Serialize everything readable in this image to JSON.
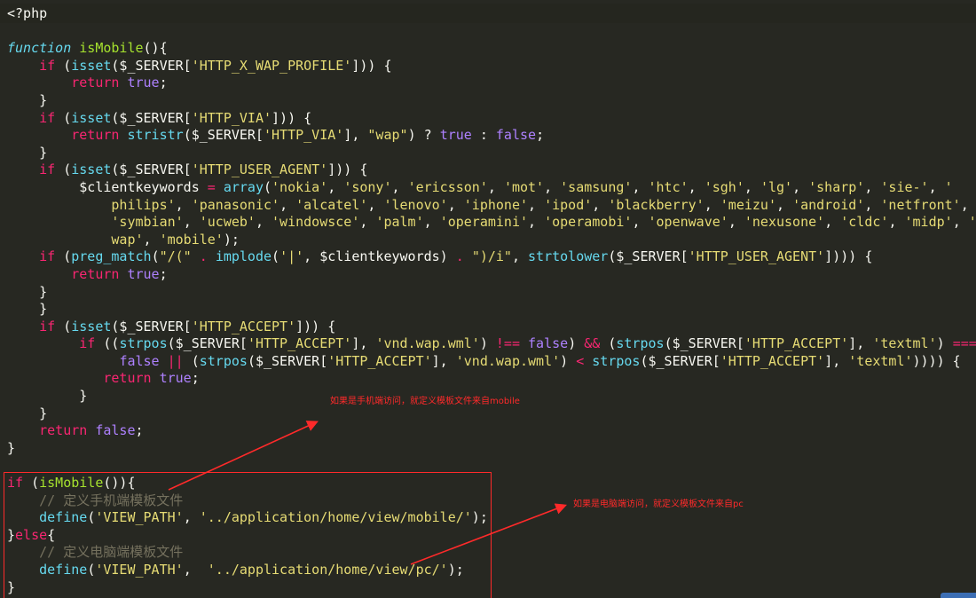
{
  "editor": {
    "lines": [
      [
        {
          "c": "pl",
          "t": "<?php"
        }
      ],
      [],
      [
        {
          "c": "fn",
          "t": "function"
        },
        {
          "c": "pl",
          "t": " "
        },
        {
          "c": "ent",
          "t": "isMobile"
        },
        {
          "c": "pl",
          "t": "(){"
        }
      ],
      [
        {
          "c": "pl",
          "t": "    "
        },
        {
          "c": "kw",
          "t": "if"
        },
        {
          "c": "pl",
          "t": " ("
        },
        {
          "c": "bi",
          "t": "isset"
        },
        {
          "c": "pl",
          "t": "($_SERVER["
        },
        {
          "c": "str",
          "t": "'HTTP_X_WAP_PROFILE'"
        },
        {
          "c": "pl",
          "t": "])) {"
        }
      ],
      [
        {
          "c": "pl",
          "t": "        "
        },
        {
          "c": "kw",
          "t": "return"
        },
        {
          "c": "pl",
          "t": " "
        },
        {
          "c": "const",
          "t": "true"
        },
        {
          "c": "pl",
          "t": ";"
        }
      ],
      [
        {
          "c": "pl",
          "t": "    }"
        }
      ],
      [
        {
          "c": "pl",
          "t": "    "
        },
        {
          "c": "kw",
          "t": "if"
        },
        {
          "c": "pl",
          "t": " ("
        },
        {
          "c": "bi",
          "t": "isset"
        },
        {
          "c": "pl",
          "t": "($_SERVER["
        },
        {
          "c": "str",
          "t": "'HTTP_VIA'"
        },
        {
          "c": "pl",
          "t": "])) {"
        }
      ],
      [
        {
          "c": "pl",
          "t": "        "
        },
        {
          "c": "kw",
          "t": "return"
        },
        {
          "c": "pl",
          "t": " "
        },
        {
          "c": "bi",
          "t": "stristr"
        },
        {
          "c": "pl",
          "t": "($_SERVER["
        },
        {
          "c": "str",
          "t": "'HTTP_VIA'"
        },
        {
          "c": "pl",
          "t": "], "
        },
        {
          "c": "str",
          "t": "\"wap\""
        },
        {
          "c": "pl",
          "t": ") ? "
        },
        {
          "c": "const",
          "t": "true"
        },
        {
          "c": "pl",
          "t": " : "
        },
        {
          "c": "const",
          "t": "false"
        },
        {
          "c": "pl",
          "t": ";"
        }
      ],
      [
        {
          "c": "pl",
          "t": "    }"
        }
      ],
      [
        {
          "c": "pl",
          "t": "    "
        },
        {
          "c": "kw",
          "t": "if"
        },
        {
          "c": "pl",
          "t": " ("
        },
        {
          "c": "bi",
          "t": "isset"
        },
        {
          "c": "pl",
          "t": "($_SERVER["
        },
        {
          "c": "str",
          "t": "'HTTP_USER_AGENT'"
        },
        {
          "c": "pl",
          "t": "])) {"
        }
      ],
      [
        {
          "c": "pl",
          "t": "         $clientkeywords "
        },
        {
          "c": "op",
          "t": "="
        },
        {
          "c": "pl",
          "t": " "
        },
        {
          "c": "bi",
          "t": "array"
        },
        {
          "c": "pl",
          "t": "("
        },
        {
          "c": "str",
          "t": "'nokia'"
        },
        {
          "c": "pl",
          "t": ", "
        },
        {
          "c": "str",
          "t": "'sony'"
        },
        {
          "c": "pl",
          "t": ", "
        },
        {
          "c": "str",
          "t": "'ericsson'"
        },
        {
          "c": "pl",
          "t": ", "
        },
        {
          "c": "str",
          "t": "'mot'"
        },
        {
          "c": "pl",
          "t": ", "
        },
        {
          "c": "str",
          "t": "'samsung'"
        },
        {
          "c": "pl",
          "t": ", "
        },
        {
          "c": "str",
          "t": "'htc'"
        },
        {
          "c": "pl",
          "t": ", "
        },
        {
          "c": "str",
          "t": "'sgh'"
        },
        {
          "c": "pl",
          "t": ", "
        },
        {
          "c": "str",
          "t": "'lg'"
        },
        {
          "c": "pl",
          "t": ", "
        },
        {
          "c": "str",
          "t": "'sharp'"
        },
        {
          "c": "pl",
          "t": ", "
        },
        {
          "c": "str",
          "t": "'sie-'"
        },
        {
          "c": "pl",
          "t": ", "
        },
        {
          "c": "str",
          "t": "'"
        }
      ],
      [
        {
          "c": "pl",
          "t": "             "
        },
        {
          "c": "str",
          "t": "philips'"
        },
        {
          "c": "pl",
          "t": ", "
        },
        {
          "c": "str",
          "t": "'panasonic'"
        },
        {
          "c": "pl",
          "t": ", "
        },
        {
          "c": "str",
          "t": "'alcatel'"
        },
        {
          "c": "pl",
          "t": ", "
        },
        {
          "c": "str",
          "t": "'lenovo'"
        },
        {
          "c": "pl",
          "t": ", "
        },
        {
          "c": "str",
          "t": "'iphone'"
        },
        {
          "c": "pl",
          "t": ", "
        },
        {
          "c": "str",
          "t": "'ipod'"
        },
        {
          "c": "pl",
          "t": ", "
        },
        {
          "c": "str",
          "t": "'blackberry'"
        },
        {
          "c": "pl",
          "t": ", "
        },
        {
          "c": "str",
          "t": "'meizu'"
        },
        {
          "c": "pl",
          "t": ", "
        },
        {
          "c": "str",
          "t": "'android'"
        },
        {
          "c": "pl",
          "t": ", "
        },
        {
          "c": "str",
          "t": "'netfront'"
        },
        {
          "c": "pl",
          "t": ","
        }
      ],
      [
        {
          "c": "pl",
          "t": "             "
        },
        {
          "c": "str",
          "t": "'symbian'"
        },
        {
          "c": "pl",
          "t": ", "
        },
        {
          "c": "str",
          "t": "'ucweb'"
        },
        {
          "c": "pl",
          "t": ", "
        },
        {
          "c": "str",
          "t": "'windowsce'"
        },
        {
          "c": "pl",
          "t": ", "
        },
        {
          "c": "str",
          "t": "'palm'"
        },
        {
          "c": "pl",
          "t": ", "
        },
        {
          "c": "str",
          "t": "'operamini'"
        },
        {
          "c": "pl",
          "t": ", "
        },
        {
          "c": "str",
          "t": "'operamobi'"
        },
        {
          "c": "pl",
          "t": ", "
        },
        {
          "c": "str",
          "t": "'openwave'"
        },
        {
          "c": "pl",
          "t": ", "
        },
        {
          "c": "str",
          "t": "'nexusone'"
        },
        {
          "c": "pl",
          "t": ", "
        },
        {
          "c": "str",
          "t": "'cldc'"
        },
        {
          "c": "pl",
          "t": ", "
        },
        {
          "c": "str",
          "t": "'midp'"
        },
        {
          "c": "pl",
          "t": ", "
        },
        {
          "c": "str",
          "t": "'"
        }
      ],
      [
        {
          "c": "pl",
          "t": "             "
        },
        {
          "c": "str",
          "t": "wap'"
        },
        {
          "c": "pl",
          "t": ", "
        },
        {
          "c": "str",
          "t": "'mobile'"
        },
        {
          "c": "pl",
          "t": ");"
        }
      ],
      [
        {
          "c": "pl",
          "t": "    "
        },
        {
          "c": "kw",
          "t": "if"
        },
        {
          "c": "pl",
          "t": " ("
        },
        {
          "c": "bi",
          "t": "preg_match"
        },
        {
          "c": "pl",
          "t": "("
        },
        {
          "c": "str",
          "t": "\"/(\""
        },
        {
          "c": "pl",
          "t": " "
        },
        {
          "c": "op",
          "t": "."
        },
        {
          "c": "pl",
          "t": " "
        },
        {
          "c": "bi",
          "t": "implode"
        },
        {
          "c": "pl",
          "t": "("
        },
        {
          "c": "str",
          "t": "'|'"
        },
        {
          "c": "pl",
          "t": ", $clientkeywords) "
        },
        {
          "c": "op",
          "t": "."
        },
        {
          "c": "pl",
          "t": " "
        },
        {
          "c": "str",
          "t": "\")/i\""
        },
        {
          "c": "pl",
          "t": ", "
        },
        {
          "c": "bi",
          "t": "strtolower"
        },
        {
          "c": "pl",
          "t": "($_SERVER["
        },
        {
          "c": "str",
          "t": "'HTTP_USER_AGENT'"
        },
        {
          "c": "pl",
          "t": "]))) {"
        }
      ],
      [
        {
          "c": "pl",
          "t": "        "
        },
        {
          "c": "kw",
          "t": "return"
        },
        {
          "c": "pl",
          "t": " "
        },
        {
          "c": "const",
          "t": "true"
        },
        {
          "c": "pl",
          "t": ";"
        }
      ],
      [
        {
          "c": "pl",
          "t": "    }"
        }
      ],
      [
        {
          "c": "pl",
          "t": "    }"
        }
      ],
      [
        {
          "c": "pl",
          "t": "    "
        },
        {
          "c": "kw",
          "t": "if"
        },
        {
          "c": "pl",
          "t": " ("
        },
        {
          "c": "bi",
          "t": "isset"
        },
        {
          "c": "pl",
          "t": "($_SERVER["
        },
        {
          "c": "str",
          "t": "'HTTP_ACCEPT'"
        },
        {
          "c": "pl",
          "t": "])) {"
        }
      ],
      [
        {
          "c": "pl",
          "t": "         "
        },
        {
          "c": "kw",
          "t": "if"
        },
        {
          "c": "pl",
          "t": " (("
        },
        {
          "c": "bi",
          "t": "strpos"
        },
        {
          "c": "pl",
          "t": "($_SERVER["
        },
        {
          "c": "str",
          "t": "'HTTP_ACCEPT'"
        },
        {
          "c": "pl",
          "t": "], "
        },
        {
          "c": "str",
          "t": "'vnd.wap.wml'"
        },
        {
          "c": "pl",
          "t": ") "
        },
        {
          "c": "op",
          "t": "!=="
        },
        {
          "c": "pl",
          "t": " "
        },
        {
          "c": "const",
          "t": "false"
        },
        {
          "c": "pl",
          "t": ") "
        },
        {
          "c": "op",
          "t": "&&"
        },
        {
          "c": "pl",
          "t": " ("
        },
        {
          "c": "bi",
          "t": "strpos"
        },
        {
          "c": "pl",
          "t": "($_SERVER["
        },
        {
          "c": "str",
          "t": "'HTTP_ACCEPT'"
        },
        {
          "c": "pl",
          "t": "], "
        },
        {
          "c": "str",
          "t": "'textml'"
        },
        {
          "c": "pl",
          "t": ") "
        },
        {
          "c": "op",
          "t": "==="
        }
      ],
      [
        {
          "c": "pl",
          "t": "              "
        },
        {
          "c": "const",
          "t": "false"
        },
        {
          "c": "pl",
          "t": " "
        },
        {
          "c": "op",
          "t": "||"
        },
        {
          "c": "pl",
          "t": " ("
        },
        {
          "c": "bi",
          "t": "strpos"
        },
        {
          "c": "pl",
          "t": "($_SERVER["
        },
        {
          "c": "str",
          "t": "'HTTP_ACCEPT'"
        },
        {
          "c": "pl",
          "t": "], "
        },
        {
          "c": "str",
          "t": "'vnd.wap.wml'"
        },
        {
          "c": "pl",
          "t": ") "
        },
        {
          "c": "op",
          "t": "<"
        },
        {
          "c": "pl",
          "t": " "
        },
        {
          "c": "bi",
          "t": "strpos"
        },
        {
          "c": "pl",
          "t": "($_SERVER["
        },
        {
          "c": "str",
          "t": "'HTTP_ACCEPT'"
        },
        {
          "c": "pl",
          "t": "], "
        },
        {
          "c": "str",
          "t": "'textml'"
        },
        {
          "c": "pl",
          "t": ")))) {"
        }
      ],
      [
        {
          "c": "pl",
          "t": "            "
        },
        {
          "c": "kw",
          "t": "return"
        },
        {
          "c": "pl",
          "t": " "
        },
        {
          "c": "const",
          "t": "true"
        },
        {
          "c": "pl",
          "t": ";"
        }
      ],
      [
        {
          "c": "pl",
          "t": "         }"
        }
      ],
      [
        {
          "c": "pl",
          "t": "    }"
        }
      ],
      [
        {
          "c": "pl",
          "t": "    "
        },
        {
          "c": "kw",
          "t": "return"
        },
        {
          "c": "pl",
          "t": " "
        },
        {
          "c": "const",
          "t": "false"
        },
        {
          "c": "pl",
          "t": ";"
        }
      ],
      [
        {
          "c": "pl",
          "t": "}"
        }
      ],
      [],
      [
        {
          "c": "kw",
          "t": "if"
        },
        {
          "c": "pl",
          "t": " ("
        },
        {
          "c": "ent",
          "t": "isMobile"
        },
        {
          "c": "pl",
          "t": "()){"
        }
      ],
      [
        {
          "c": "pl",
          "t": "    "
        },
        {
          "c": "cmt",
          "t": "// 定义手机端模板文件"
        }
      ],
      [
        {
          "c": "pl",
          "t": "    "
        },
        {
          "c": "bi",
          "t": "define"
        },
        {
          "c": "pl",
          "t": "("
        },
        {
          "c": "str",
          "t": "'VIEW_PATH'"
        },
        {
          "c": "pl",
          "t": ", "
        },
        {
          "c": "str",
          "t": "'../application/home/view/mobile/'"
        },
        {
          "c": "pl",
          "t": ");"
        }
      ],
      [
        {
          "c": "pl",
          "t": "}"
        },
        {
          "c": "kw",
          "t": "else"
        },
        {
          "c": "pl",
          "t": "{"
        }
      ],
      [
        {
          "c": "pl",
          "t": "    "
        },
        {
          "c": "cmt",
          "t": "// 定义电脑端模板文件"
        }
      ],
      [
        {
          "c": "pl",
          "t": "    "
        },
        {
          "c": "bi",
          "t": "define"
        },
        {
          "c": "pl",
          "t": "("
        },
        {
          "c": "str",
          "t": "'VIEW_PATH'"
        },
        {
          "c": "pl",
          "t": ",  "
        },
        {
          "c": "str",
          "t": "'../application/home/view/pc/'"
        },
        {
          "c": "pl",
          "t": ");"
        }
      ],
      [
        {
          "c": "pl",
          "t": "}"
        }
      ]
    ]
  },
  "annotations": {
    "mobile_note": "如果是手机端访问，就定义模板文件来自mobile",
    "pc_note": "如果是电脑端访问，就定义模板文件来自pc",
    "color": "#ff2a2a"
  },
  "theme": {
    "background": "#272822",
    "keyword": "#f92672",
    "string": "#e6db74",
    "constant": "#ae81ff",
    "builtin": "#66d9ef",
    "function_name": "#a6e22e",
    "comment": "#75715e",
    "plain": "#f8f8f2"
  }
}
